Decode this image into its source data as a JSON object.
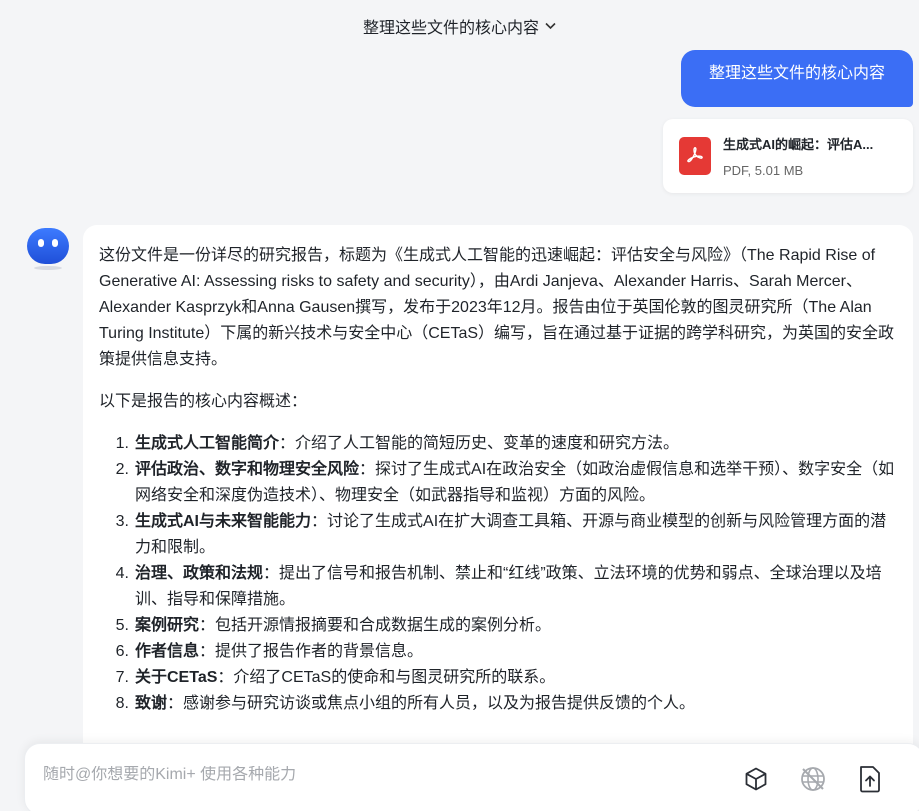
{
  "header": {
    "title": "整理这些文件的核心内容",
    "chevron_icon": "chevron-down-icon"
  },
  "user_message": {
    "text": "整理这些文件的核心内容"
  },
  "attachment": {
    "name": "生成式AI的崛起：评估A...",
    "meta": "PDF, 5.01 MB",
    "icon": "pdf-icon",
    "color": "#e53935"
  },
  "assistant": {
    "avatar_icon": "kimi-avatar-icon",
    "intro": "这份文件是一份详尽的研究报告，标题为《生成式人工智能的迅速崛起：评估安全与风险》（The Rapid Rise of Generative AI: Assessing risks to safety and security），由Ardi Janjeva、Alexander Harris、Sarah Mercer、Alexander Kasprzyk和Anna Gausen撰写，发布于2023年12月。报告由位于英国伦敦的图灵研究所（The Alan Turing Institute）下属的新兴技术与安全中心（CETaS）编写，旨在通过基于证据的跨学科研究，为英国的安全政策提供信息支持。",
    "summary_heading": "以下是报告的核心内容概述：",
    "items": [
      {
        "num": "1.",
        "title": "生成式人工智能简介",
        "text": "：介绍了人工智能的简短历史、变革的速度和研究方法。"
      },
      {
        "num": "2.",
        "title": "评估政治、数字和物理安全风险",
        "text": "：探讨了生成式AI在政治安全（如政治虚假信息和选举干预）、数字安全（如网络安全和深度伪造技术）、物理安全（如武器指导和监视）方面的风险。"
      },
      {
        "num": "3.",
        "title": "生成式AI与未来智能能力",
        "text": "：讨论了生成式AI在扩大调查工具箱、开源与商业模型的创新与风险管理方面的潜力和限制。"
      },
      {
        "num": "4.",
        "title": "治理、政策和法规",
        "text": "：提出了信号和报告机制、禁止和“红线”政策、立法环境的优势和弱点、全球治理以及培训、指导和保障措施。"
      },
      {
        "num": "5.",
        "title": "案例研究",
        "text": "：包括开源情报摘要和合成数据生成的案例分析。"
      },
      {
        "num": "6.",
        "title": "作者信息",
        "text": "：提供了报告作者的背景信息。"
      },
      {
        "num": "7.",
        "title": "关于CETaS",
        "text": "：介绍了CETaS的使命和与图灵研究所的联系。"
      },
      {
        "num": "8.",
        "title": "致谢",
        "text": "：感谢参与研究访谈或焦点小组的所有人员，以及为报告提供反馈的个人。"
      }
    ]
  },
  "composer": {
    "placeholder": "随时@你想要的Kimi+ 使用各种能力",
    "tools": [
      "cube-icon",
      "web-search-off-icon",
      "upload-file-icon"
    ]
  },
  "colors": {
    "accent": "#3b6ef5",
    "background": "#f4f5f7",
    "pdf": "#e53935"
  }
}
